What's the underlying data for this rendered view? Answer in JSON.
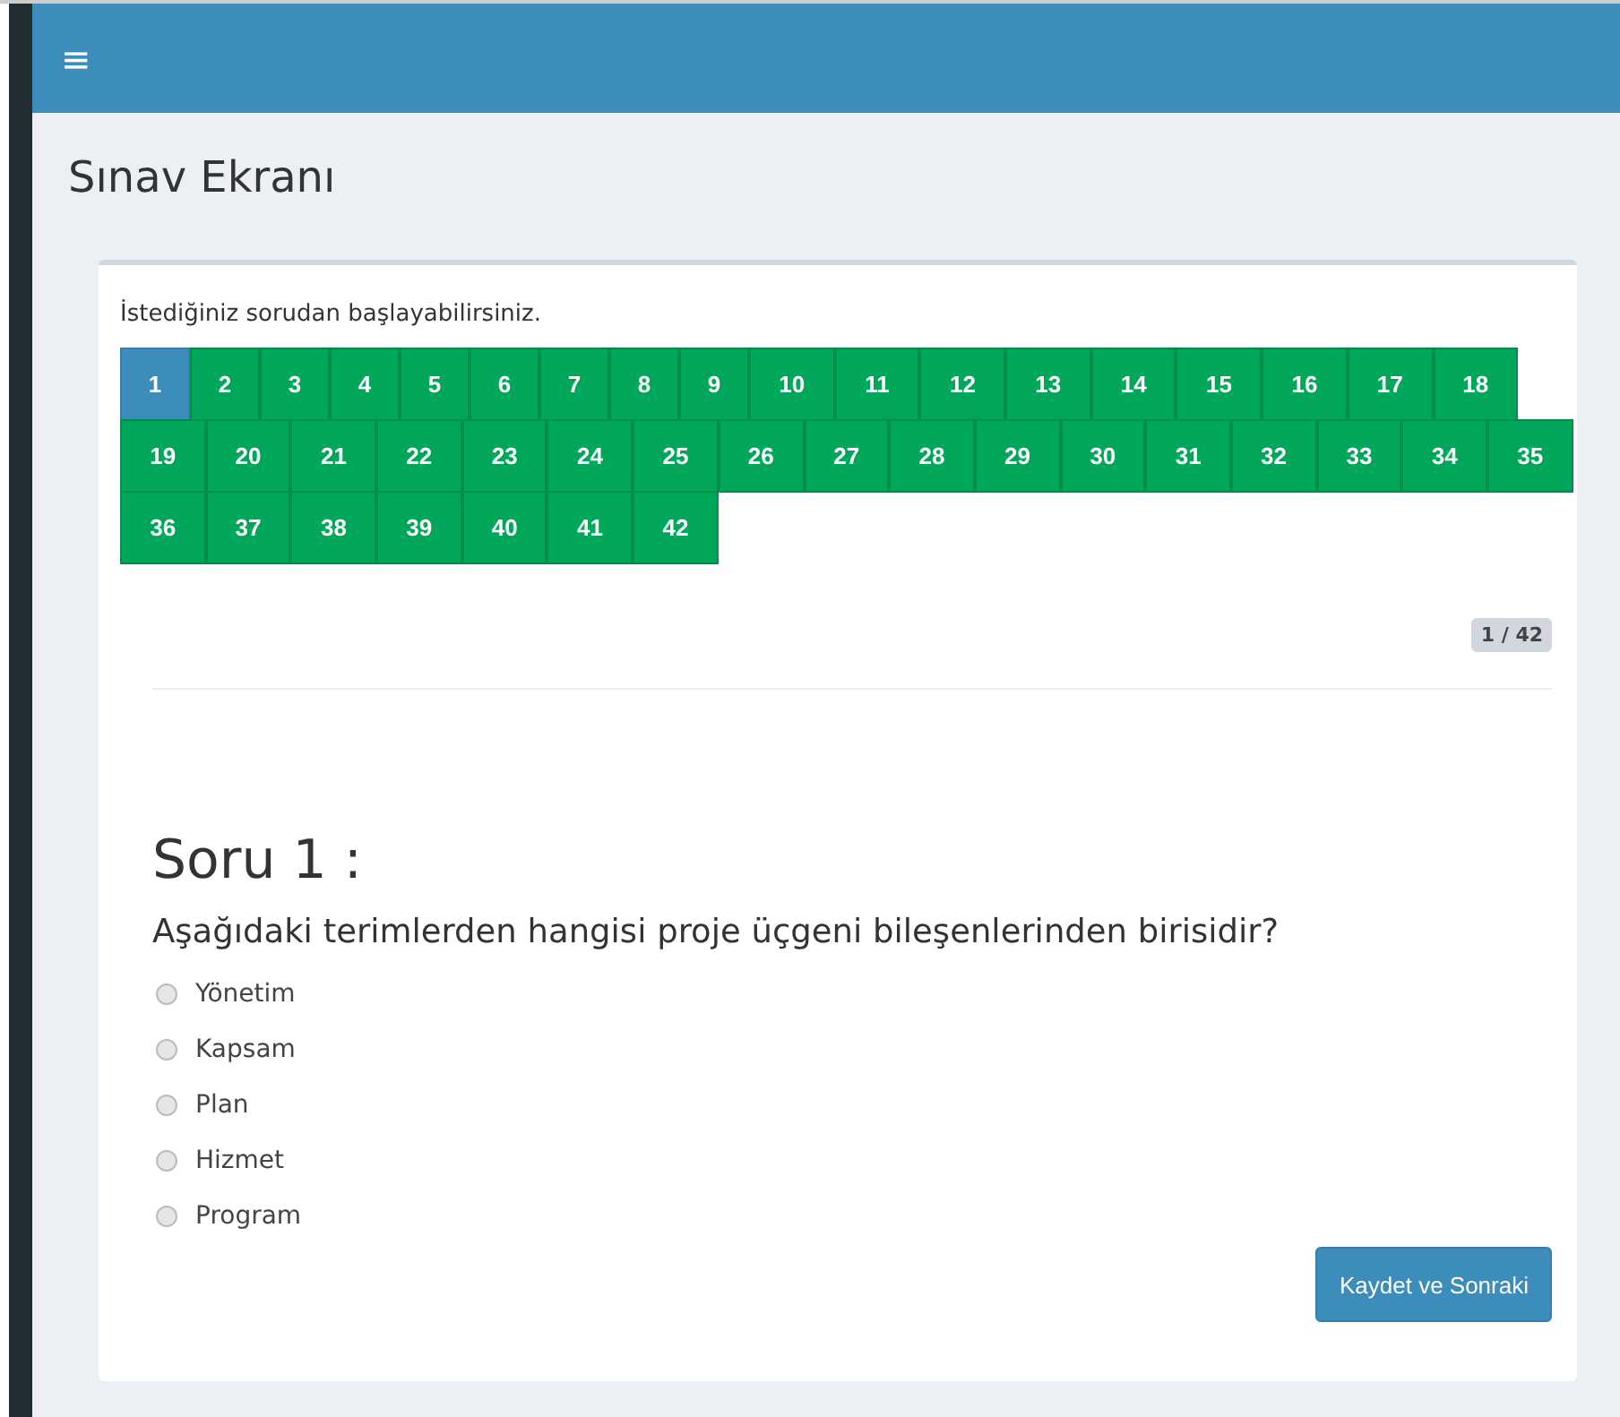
{
  "topbar": {
    "menu_icon": "≡"
  },
  "page_title": "Sınav Ekranı",
  "intro": "İstediğiniz sorudan başlayabilirsiniz.",
  "questions": [
    {
      "label": "1",
      "selected": true
    },
    {
      "label": "2",
      "selected": false
    },
    {
      "label": "3",
      "selected": false
    },
    {
      "label": "4",
      "selected": false
    },
    {
      "label": "5",
      "selected": false
    },
    {
      "label": "6",
      "selected": false
    },
    {
      "label": "7",
      "selected": false
    },
    {
      "label": "8",
      "selected": false
    },
    {
      "label": "9",
      "selected": false
    },
    {
      "label": "10",
      "selected": false
    },
    {
      "label": "11",
      "selected": false
    },
    {
      "label": "12",
      "selected": false
    },
    {
      "label": "13",
      "selected": false
    },
    {
      "label": "14",
      "selected": false
    },
    {
      "label": "15",
      "selected": false
    },
    {
      "label": "16",
      "selected": false
    },
    {
      "label": "17",
      "selected": false
    },
    {
      "label": "18",
      "selected": false
    },
    {
      "label": "19",
      "selected": false
    },
    {
      "label": "20",
      "selected": false
    },
    {
      "label": "21",
      "selected": false
    },
    {
      "label": "22",
      "selected": false
    },
    {
      "label": "23",
      "selected": false
    },
    {
      "label": "24",
      "selected": false
    },
    {
      "label": "25",
      "selected": false
    },
    {
      "label": "26",
      "selected": false
    },
    {
      "label": "27",
      "selected": false
    },
    {
      "label": "28",
      "selected": false
    },
    {
      "label": "29",
      "selected": false
    },
    {
      "label": "30",
      "selected": false
    },
    {
      "label": "31",
      "selected": false
    },
    {
      "label": "32",
      "selected": false
    },
    {
      "label": "33",
      "selected": false
    },
    {
      "label": "34",
      "selected": false
    },
    {
      "label": "35",
      "selected": false
    },
    {
      "label": "36",
      "selected": false
    },
    {
      "label": "37",
      "selected": false
    },
    {
      "label": "38",
      "selected": false
    },
    {
      "label": "39",
      "selected": false
    },
    {
      "label": "40",
      "selected": false
    },
    {
      "label": "41",
      "selected": false
    },
    {
      "label": "42",
      "selected": false
    }
  ],
  "progress": "1 / 42",
  "question_title": "Soru 1 :",
  "question_text": "Aşağıdaki terimlerden hangisi proje üçgeni bileşenlerinden birisidir?",
  "options": [
    {
      "label": "Yönetim",
      "selected": false
    },
    {
      "label": "Kapsam",
      "selected": false
    },
    {
      "label": "Plan",
      "selected": false
    },
    {
      "label": "Hizmet",
      "selected": false
    },
    {
      "label": "Program",
      "selected": false
    }
  ],
  "submit_button": "Kaydet ve Sonraki"
}
